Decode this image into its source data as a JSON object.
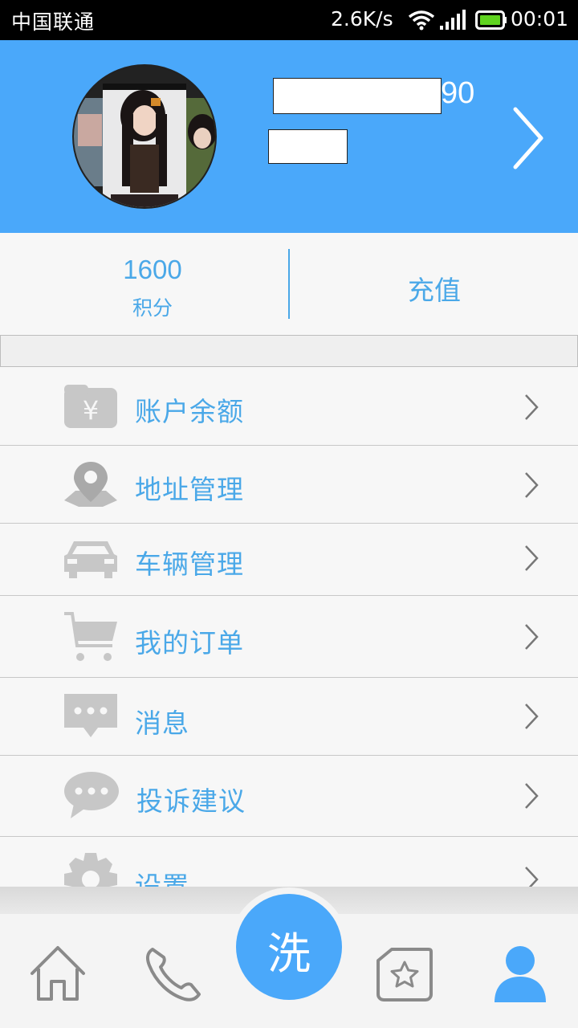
{
  "status_bar": {
    "carrier": "中国联通",
    "net_speed": "2.6K/s",
    "time": "00:01"
  },
  "profile": {
    "username_visible_suffix": "90"
  },
  "stats": {
    "points_value": "1600",
    "points_label": "积分",
    "recharge_label": "充值"
  },
  "menu": {
    "items": [
      {
        "label": "账户余额",
        "icon": "wallet-icon"
      },
      {
        "label": "地址管理",
        "icon": "location-pin-icon"
      },
      {
        "label": "车辆管理",
        "icon": "car-icon"
      },
      {
        "label": "我的订单",
        "icon": "cart-icon"
      },
      {
        "label": "消息",
        "icon": "message-icon"
      },
      {
        "label": "投诉建议",
        "icon": "chat-bubble-icon"
      },
      {
        "label": "设置",
        "icon": "gear-icon"
      }
    ]
  },
  "tab_bar": {
    "wash_label": "洗",
    "tabs": [
      "home-icon",
      "phone-icon",
      "wash-button",
      "favorites-star-icon",
      "profile-person-icon"
    ],
    "active_tab": "profile-person-icon",
    "accent_color": "#4aa8fa",
    "inactive_color": "#8a8a8a"
  },
  "colors": {
    "header_blue": "#4aa8fa",
    "text_blue": "#4aa8e8",
    "icon_gray": "#c7c7c7"
  }
}
